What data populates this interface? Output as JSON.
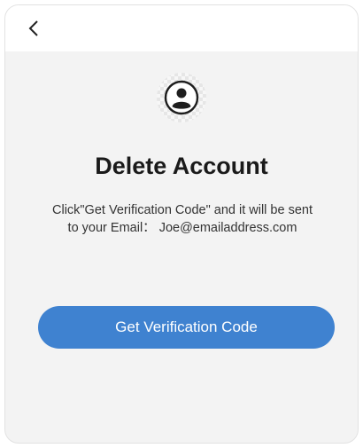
{
  "header": {
    "back_icon": "chevron-left-icon"
  },
  "profile": {
    "avatar_icon": "user-avatar-icon"
  },
  "page": {
    "title": "Delete Account",
    "description_line1": "Click\"Get Verification Code\" and it will be sent",
    "description_line2": "to your Email：  Joe@emailaddress.com"
  },
  "actions": {
    "get_code_label": "Get Verification Code"
  },
  "colors": {
    "accent": "#3f82d0",
    "background": "#f3f3f3",
    "header": "#ffffff"
  }
}
